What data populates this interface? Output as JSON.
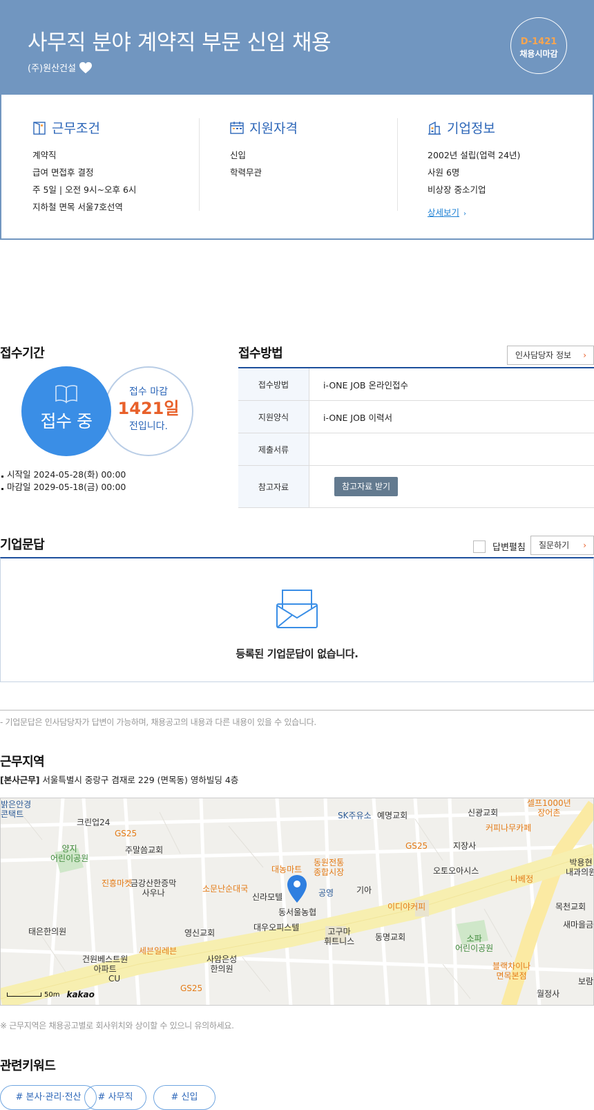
{
  "header": {
    "title": "사무직 분야 계약직 부문 신입 채용",
    "company": "(주)원산건설",
    "dday": "D-1421",
    "dday_status": "채용시마감"
  },
  "info": {
    "work": {
      "title": "근무조건",
      "lines": [
        "계약직",
        "급여 면접후 결정",
        "주 5일 | 오전 9시~오후 6시",
        "지하철 면목 서울7호선역"
      ]
    },
    "qualification": {
      "title": "지원자격",
      "lines": [
        "신입",
        "학력무관"
      ]
    },
    "company": {
      "title": "기업정보",
      "lines": [
        "2002년 설립(업력 24년)",
        "사원 6명",
        "비상장 중소기업"
      ],
      "more": "상세보기"
    }
  },
  "reception": {
    "title": "접수기간",
    "status": "접수 중",
    "deadline_l1": "접수 마감",
    "deadline_days": "1421일",
    "deadline_l3": "전입니다.",
    "start": "시작일 2024-05-28(화) 00:00",
    "end": "마감일 2029-05-18(금) 00:00"
  },
  "method": {
    "title": "접수방법",
    "hr_button": "인사담당자 정보",
    "rows": [
      {
        "label": "접수방법",
        "value": "i-ONE JOB 온라인접수"
      },
      {
        "label": "지원양식",
        "value": "i-ONE JOB 이력서"
      },
      {
        "label": "제출서류",
        "value": ""
      },
      {
        "label": "참고자료",
        "button": "참고자료 받기"
      }
    ]
  },
  "qa": {
    "title": "기업문답",
    "toggle": "답변펼침",
    "ask_button": "질문하기",
    "empty": "등록된 기업문답이 없습니다.",
    "note": "- 기업문답은 인사담당자가 답변이 가능하며, 채용공고의 내용과 다른 내용이 있을 수 있습니다."
  },
  "location": {
    "title": "근무지역",
    "tag": "[본사근무]",
    "address": "서울특별시 중랑구 겸재로 229 (면목동) 영하빌딩 4층",
    "note": "※ 근무지역은 채용공고별로 회사위치와 상이할 수 있으니 유의하세요.",
    "scale": "50m",
    "brand": "kakao",
    "pois": [
      "크린업24",
      "GS25",
      "양지\n어린이공원",
      "주말씀교회",
      "진흥마켓",
      "금강산한증막\n사우나",
      "소문난순대국",
      "대농마트",
      "동원전통\n종합시장",
      "신라모텔",
      "공영",
      "기아",
      "동서울농협",
      "대우오피스텔",
      "고구마\n휘트니스",
      "이디야커피",
      "동명교회",
      "SK주유소",
      "예명교회",
      "GS25",
      "신광교회",
      "커피나무카페",
      "지장사",
      "오토오아시스",
      "나베정",
      "셀프1000년\n장어촌",
      "박용현\n내과의원",
      "목천교회",
      "새마을금",
      "소파\n어린이공원",
      "블랙차이나\n면목본점",
      "월정사",
      "보람",
      "태은한의원",
      "영신교회",
      "세븐일레븐",
      "밝은안경\n콘택트",
      "사암은성\n한의원",
      "건원베스트원\n아파트",
      "CU",
      "GS25"
    ]
  },
  "keywords": {
    "title": "관련키워드",
    "items": [
      "# 본사·관리·전산",
      "# 사무직",
      "# 신입"
    ]
  },
  "colors": {
    "header_bg": "#7196c0",
    "accent_blue": "#3a8ee6",
    "deadline_orange": "#e8602a",
    "navy_rule": "#1c4f9c"
  }
}
